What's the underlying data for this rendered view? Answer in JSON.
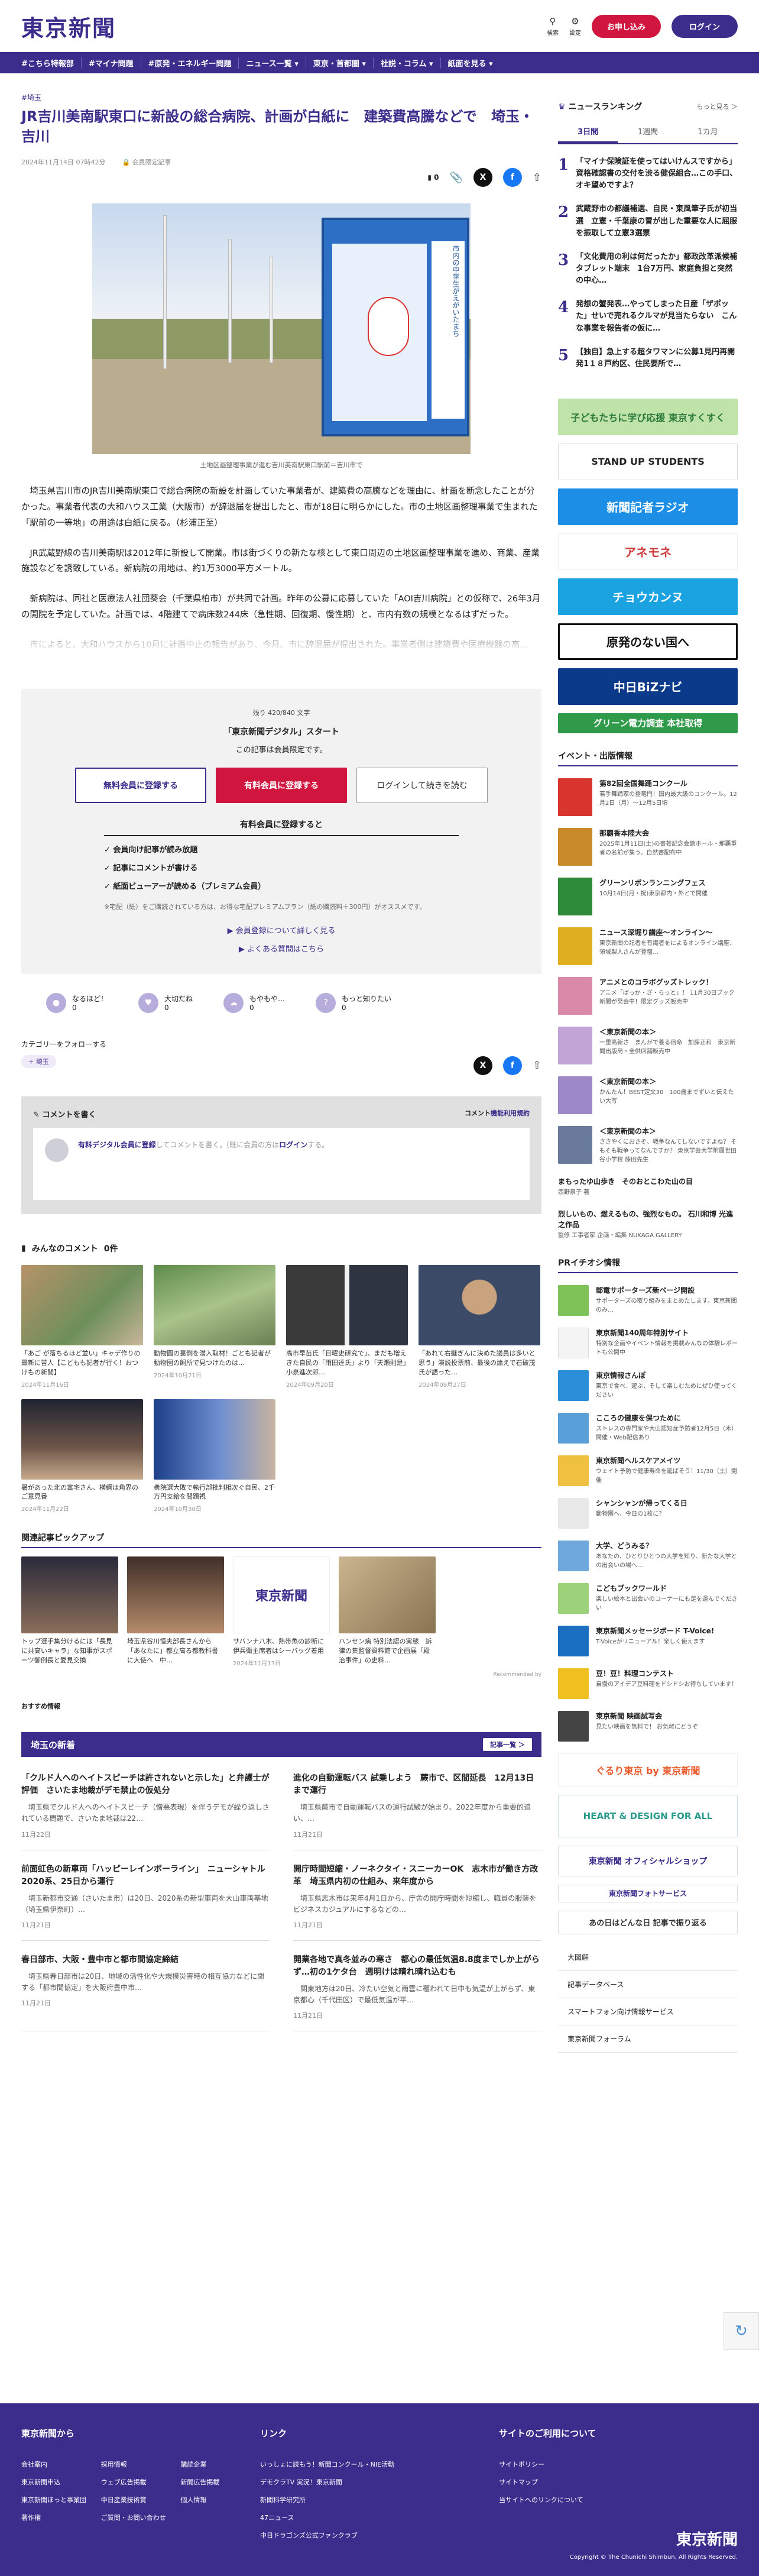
{
  "brand": {
    "logo": "東京新聞",
    "search": "検索",
    "settings": "設定",
    "register": "お申し込み",
    "login": "ログイン"
  },
  "nav": [
    "#こちら特報部",
    "#マイナ問題",
    "#原発・エネルギー問題",
    "ニュース一覧 ▾",
    "東京・首都圏 ▾",
    "社説・コラム ▾",
    "紙面を見る ▾"
  ],
  "article": {
    "category": "#埼玉",
    "title": "JR吉川美南駅東口に新設の総合病院、計画が白紙に　建築費高騰などで　埼玉・吉川",
    "date": "2024年11月14日 07時42分",
    "members": "会員限定記事",
    "comment_count": "0",
    "caption": "土地区画整理事業が進む吉川美南駅東口駅前＝吉川市で",
    "paragraphs": [
      "　埼玉県吉川市のJR吉川美南駅東口で総合病院の新設を計画していた事業者が、建築費の高騰などを理由に、計画を断念したことが分かった。事業者代表の大和ハウス工業（大阪市）が辞退届を提出したと、市が18日に明らかにした。市の土地区画整理事業で生まれた「駅前の一等地」の用途は白紙に戻る。（杉浦正至）",
      "　JR武蔵野線の吉川美南駅は2012年に新設して開業。市は街づくりの新たな核として東口周辺の土地区画整理事業を進め、商業、産業施設などを誘致している。新病院の用地は、約1万3000平方メートル。",
      "　新病院は、同社と医療法人社団葵会（千葉県柏市）が共同で計画。昨年の公募に応募していた「AOI吉川病院」との仮称で、26年3月の開院を予定していた。計画では、4階建てで病床数244床（急性期、回復期、慢性期）と、市内有数の規模となるはずだった。",
      "　市によると、大和ハウスから10月に計画中止の報告があり、今月、市に辞退届が提出された。事業者側は建築費や医療機器の高…"
    ]
  },
  "paywall": {
    "chars": "残り 420/840 文字",
    "title": "「東京新聞デジタル」スタート",
    "sub": "この記事は会員限定です。",
    "btn_free": "無料会員に登録する",
    "btn_paid": "有料会員に登録する",
    "btn_login": "ログインして続きを読む",
    "benefit_title": "有料会員に登録すると",
    "benefits": [
      "✓ 会員向け記事が読み放題",
      "✓ 記事にコメントが書ける",
      "✓ 紙面ビューアーが読める（プレミアム会員）"
    ],
    "note": "※宅配（紙）をご購読されている方は、お得な宅配プレミアムプラン（紙の購読料＋300円）がオススメです。",
    "link1": "▶ 会員登録について詳しく見る",
    "link2": "▶ よくある質問はこちら"
  },
  "reactions": [
    {
      "label": "なるほど！",
      "count": "0"
    },
    {
      "label": "大切だね",
      "count": "0"
    },
    {
      "label": "もやもや…",
      "count": "0"
    },
    {
      "label": "もっと知りたい",
      "count": "0"
    }
  ],
  "follow": {
    "label": "カテゴリーをフォローする",
    "tag": "埼玉"
  },
  "comment": {
    "head": "コメントを書く",
    "policy": "コメント",
    "policy_link": "機能利用規約",
    "lead": "有料デジタル会員に登録",
    "placeholder": "してコメントを書く。(既に会員の方は",
    "login": "ログイン",
    "end": "する。"
  },
  "minna": {
    "title": "みんなのコメント",
    "count": "0件",
    "cards": [
      {
        "text": "「あご が落ちるほど並い」キャデ作りの最新に苦人【こどもも記者が行く！おつけもの新聞】",
        "date": "2024年11月16日"
      },
      {
        "text": "動物園の裏側を潜入取材！ごとも記者が動物園の飼所で見つけたのは…",
        "date": "2024年10月21日"
      },
      {
        "text": "高市早苗氏「日曜史研究で」、まだも増えきた自民の「雨田達氏」より「天瀬則是」小泉進次郎…",
        "date": "2024年09月20日"
      },
      {
        "text": "「あれて右継ぎんに決めた議員は多いと思う」演説投票前、最後の論えで石破茂氏が語った…",
        "date": "2024年09月27日"
      },
      {
        "text": "暑があった北の富宅さん、横綱は角界のご意見番",
        "date": "2024年11月22日"
      },
      {
        "text": "衆院選大敗で執行部批判相次ぐ自民、2千万円支給を問題視",
        "date": "2024年10月30日"
      }
    ]
  },
  "pickup": {
    "title": "関連記事ピックアップ",
    "cards": [
      {
        "text": "トップ選手集分けるには「長見に共高いキャラ」な知事がスポーツ御例長と愛見交換",
        "date": ""
      },
      {
        "text": "埼玉県谷川恒夫部長さんから「あなたに」都立高る都教科書に大使へ　中…",
        "date": ""
      },
      {
        "text": "サバンナ八木、熱帯魚の診断に伊兵衛主席者はシーバッグ着用",
        "date": "2024年11月13日"
      },
      {
        "text": "ハンセン病 特別法認の実態　訴律の集監督資料館で企画展「殿治事件」の史料…",
        "date": ""
      },
      {
        "text": "",
        "date": ""
      }
    ],
    "recommended": "Recommended by"
  },
  "osusume": "おすすめ情報",
  "saitama": {
    "title": "埼玉の新着",
    "more": "記事一覧 ＞",
    "items": [
      {
        "title": "「クルド人へのヘイトスピーチは許されないと示した」と弁護士が評価　さいたま地裁がデモ禁止の仮処分",
        "body": "　埼玉県でクルド人へのヘイトスピーチ（憎悪表現）を伴うデモが繰り返しされている問題で、さいたま地裁は22…",
        "date": "11月22日"
      },
      {
        "title": "進化の自動運転バス 試乗しよう　蕨市で、区間延長　12月13日まで運行",
        "body": "　埼玉県蕨市で自動運転バスの運行試験が始まり、2022年度から重要的追い、…",
        "date": "11月21日"
      },
      {
        "title": "前面虹色の新車両「ハッピーレインボーライン」　ニューシャトル2020系、25日から運行",
        "body": "　埼玉新都市交通（さいたま市）は20日、2020系の新型車両を大山車両基地（埼玉県伊奈町）…",
        "date": "11月21日"
      },
      {
        "title": "開庁時間短縮・ノーネクタイ・スニーカーOK　志木市が働き方改革　埼玉県内初の仕組み、来年度から",
        "body": "　埼玉県志木市は来年4月1日から、庁舎の開庁時間を短縮し、職員の服装をビジネスカジュアルにするなどの…",
        "date": "11月21日"
      },
      {
        "title": "春日部市、大阪・豊中市と都市間協定締結",
        "body": "　埼玉県春日部市は20日、地域の活性化や大規模災害時の相互協力などに関する「都市間協定」を大阪府豊中市…",
        "date": "11月21日"
      },
      {
        "title": "開業各地で真冬並みの寒さ　都心の最低気温8.8度までしか上がらず…初の1ケタ台　週明けは晴れ晴れ込むも",
        "body": "　関東地方は20日、冷たい空気と雨雲に覆われて日中も気温が上がらず、東京都心（千代田区）で最低気温が平…",
        "date": "11月21日"
      }
    ]
  },
  "ranking": {
    "title": "ニュースランキング",
    "more": "もっと見る ＞",
    "tabs": [
      "3日間",
      "1週間",
      "1カ月"
    ],
    "items": [
      {
        "n": "1",
        "t": "「マイナ保険証を使ってはいけんスですから」資格確認書の交付を渋る健保組合…この手口、オキ望めですよ？"
      },
      {
        "n": "2",
        "t": "武蔵野市の都議補選、自民・東風筆子氏が初当選　立憲・千葉康の冒が出した重要な人に屈服を振取して立憲3選票"
      },
      {
        "n": "3",
        "t": "「文化費用の利は何だったか」都政改革派候補タブレット端末　1台7万円、家庭負担と突然の中心…"
      },
      {
        "n": "4",
        "t": "発想の蟹発表…やってしまった日産「ザポッた」せいで売れるクルマが見当たらない　こんな事業を報告者の仮に…"
      },
      {
        "n": "5",
        "t": "【独自】急上する超タワマンに公募1見円再開発1１８戸約区、住民要所で…"
      }
    ]
  },
  "banners": [
    {
      "text": "子どもたちに学び応援 東京すくすく",
      "bg": "#bfe3a8",
      "fg": "#2c7a3c"
    },
    {
      "text": "STAND UP STUDENTS",
      "bg": "#ffffff",
      "fg": "#222"
    },
    {
      "text": "新聞記者ラジオ",
      "bg": "#1d8ee6",
      "fg": "#fff"
    },
    {
      "text": "アネモネ",
      "bg": "#ffffff",
      "fg": "#d23a3a"
    },
    {
      "text": "チョウカンヌ",
      "bg": "#1aa3e0",
      "fg": "#fff"
    },
    {
      "text": "原発のない国へ",
      "bg": "#ffffff",
      "fg": "#111"
    },
    {
      "text": "中日BiZナビ",
      "bg": "#0c3a8a",
      "fg": "#fff"
    },
    {
      "text": "グリーン電力調査 本社取得",
      "bg": "#2f9a4a",
      "fg": "#fff"
    }
  ],
  "events": {
    "title": "イベント・出版情報",
    "items": [
      {
        "t": "第82回全国舞踊コンクール",
        "s": "若手舞踊家の登竜門！国内最大級のコンクール。12月2日（月）〜12月5日頃",
        "c": "#d7352e"
      },
      {
        "t": "那覇香本陸大会",
        "s": "2025年1月11日(土)の書芸記念会館ホール・那覇重者の名前が集う。自然書配布中",
        "c": "#c98b2a"
      },
      {
        "t": "グリーンリボンランニングフェス",
        "s": "10月14日(月・祝)東京都内・外とで開催",
        "c": "#2d8b3a"
      },
      {
        "t": "ニュース深堀り講座〜オンライン〜",
        "s": "東京新聞の記者を有識者をによるオンライン講座、領域製人さんが登壇…",
        "c": "#e0b020"
      },
      {
        "t": "アニメとのコラボグッズトレック！",
        "s": "アニメ「ばっか・ざ・らっと」！ 11月30日ブック新聞が発会中！限定グッズ販売中",
        "c": "#d88aa8"
      },
      {
        "t": "＜東京新聞の本＞",
        "s": "一里高新さ　まんがで養る宿命　加藤正和　東京新聞出版局・全供店舗販売中",
        "c": "#c3a4d6"
      },
      {
        "t": "＜東京新聞の本＞",
        "s": "かんたん！BEST定文30　100歳までずいと伝えたい大写",
        "c": "#9d88c8"
      },
      {
        "t": "＜東京新聞の本＞",
        "s": "ささやくにおさぞ、戦争なんてしないですよね？ そもそも戦争ってなんですか？ 東京学芸大学附属世田谷小学校 藤田先生",
        "c": "#6a7a9a"
      },
      {
        "t": "まもったゆ山歩き　そのおとこわた山の目",
        "s": "西野泉子 著",
        "c": "#a0b8d6"
      },
      {
        "t": "烈しいもの、燃えるもの、強烈なもの。 石川和博 光進之作品",
        "s": "監修 工事者家 企画・編集 NUKAGA GALLERY",
        "c": "#d44"
      }
    ]
  },
  "pr": {
    "title": "PRイチオシ情報",
    "items": [
      {
        "t": "郵電サポーターズ新ページ開設",
        "s": "サポーターズの取り組みをまとめたします。東京新聞のみ…",
        "c": "#7fc257"
      },
      {
        "t": "東京新聞140周年特別サイト",
        "s": "特別な企画やイベント情報を掲載みんなの体験レポートも公開中",
        "c": "#f4f4f4"
      },
      {
        "t": "東京情報さんぽ",
        "s": "東京で食べ、遊ぶ、そして楽しむためにぜひ使ってください",
        "c": "#2a8ed8"
      },
      {
        "t": "こころの健康を保つために",
        "s": "ストレスの専門家や大山認知症予防者12月5日（木）開催・Web配信あり",
        "c": "#5aa0d8"
      },
      {
        "t": "東京新聞ヘルスケアメイツ",
        "s": "ウェイト予防で健康寿命を延ばそう！11/30（土）開催",
        "c": "#f0c040"
      },
      {
        "t": "シャンシャンが帰ってくる日",
        "s": "動物園へ、今日の1枚に？",
        "c": "#e8e8e8"
      },
      {
        "t": "大学、どうみる？",
        "s": "あなたの、ひとりひとつの大学を知り、新たな大学との出会いの場へ…",
        "c": "#6fa8dc"
      },
      {
        "t": "こどもブックワールド",
        "s": "楽しい絵本と出会いのコーナーにも足を運んでください",
        "c": "#9bd27a"
      },
      {
        "t": "東京新聞メッセージボード T-Voice!",
        "s": "T-Voiceがリニューアル！楽しく使えます",
        "c": "#1a6fc0"
      },
      {
        "t": "豆！豆！料理コンテスト",
        "s": "自慢のアイデア豆料理をドシドシお待ちしています！",
        "c": "#f0c020"
      },
      {
        "t": "東京新聞 映画試写会",
        "s": "見たい映画を無料で！ お気軽にどうぞ",
        "c": "#444"
      }
    ]
  },
  "bottom_banners": [
    {
      "text": "ぐるり東京 by 東京新聞",
      "bg": "#ffffff",
      "fg": "#e85a2a"
    },
    {
      "text": "HEART & DESIGN FOR ALL",
      "bg": "#ffffff",
      "fg": "#2a9a8a"
    },
    {
      "text": "東京新聞 オフィシャルショップ",
      "bg": "#ffffff",
      "fg": "#3c2d8c"
    },
    {
      "text": "東京新聞フォトサービス",
      "bg": "#ffffff",
      "fg": "#3c2d8c"
    },
    {
      "text": "あの日はどんな日 記事で振り返る",
      "bg": "#ffffff",
      "fg": "#333"
    }
  ],
  "side_links": [
    "大図解",
    "記事データベース",
    "スマートフォン向け情報サービス",
    "東京新聞フォーラム"
  ],
  "footer": {
    "col1": {
      "title": "東京新聞から",
      "links": [
        "会社案内",
        "採用情報",
        "購読企業",
        "東京新聞申込",
        "ウェブ広告掲載",
        "新聞広告掲載",
        "東京新聞ほっと事業団",
        "中日産業技術賞",
        "個人情報",
        "著作権",
        "ご質問・お問い合わせ",
        ""
      ]
    },
    "col2": {
      "title": "リンク",
      "links": [
        "いっしょに読もう！新聞コンクール・NIE活動",
        "デモクラTV 実況！東京新聞",
        "新聞科学研究所",
        "47ニュース",
        "中日ドラゴンズ公式ファンクラブ"
      ]
    },
    "col3": {
      "title": "サイトのご利用について",
      "links": [
        "サイトポリシー",
        "サイトマップ",
        "当サイトへのリンクについて"
      ]
    },
    "logo": "東京新聞",
    "copyright": "Copyright © The Chunichi Shimbun, All Rights Reserved."
  }
}
